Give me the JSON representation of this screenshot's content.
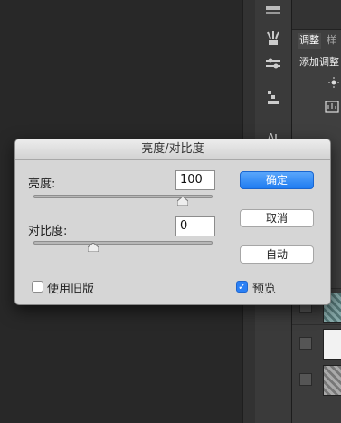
{
  "panel": {
    "tab_adjust": "调整",
    "tab_style": "样",
    "add_adjust_heading": "添加调整"
  },
  "dialog": {
    "title": "亮度/对比度",
    "brightness_label": "亮度:",
    "brightness_value": "100",
    "brightness_level": 100,
    "contrast_label": "对比度:",
    "contrast_value": "0",
    "contrast_level": 0,
    "ok_label": "确定",
    "cancel_label": "取消",
    "auto_label": "自动",
    "legacy_label": "使用旧版",
    "legacy_checked": false,
    "preview_label": "预览",
    "preview_checked": true
  }
}
